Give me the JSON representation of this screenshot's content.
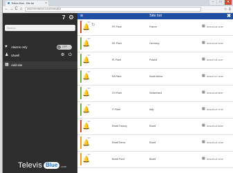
{
  "browser": {
    "tab_title": "Televis Blue - Site list",
    "url": "www.televisblue.com/#/sites/list",
    "win_min": "–",
    "win_max": "□",
    "win_close": "✕",
    "back": "←",
    "forward": "→",
    "reload": "C",
    "home": "⌂",
    "addr_right": "☆ ≡"
  },
  "sidebar": {
    "top_number": "7",
    "top_icon": "⚙",
    "search_placeholder": "Search",
    "alarms_label": "Alarms only",
    "alarms_icon": "♥",
    "toggle_label": "OFF",
    "user_label": "Utwell",
    "user_icon": "♟",
    "user_actions": "⚙ ⏻",
    "add_site_label": "Add site",
    "add_site_icon": "▦",
    "logo_word": "Televis",
    "logo_blue": "Blue",
    "logo_suffix": ".com"
  },
  "main": {
    "menu_icon": "≡",
    "title": "Site list",
    "close_icon": "✖"
  },
  "colors": {
    "ok": "#6fb04a",
    "alarm": "#d94a2a",
    "warning": "#f0a020",
    "header": "#1f4fa0",
    "sidebar": "#2d2d2d"
  },
  "rows": [
    {
      "bell": "🔔",
      "status": "alarm",
      "tag": "SM",
      "extra": "↻",
      "name": "FR Plant",
      "country": "France",
      "cal": "▦",
      "date": "2019-04-22 12:06"
    },
    {
      "bell": "🔔",
      "status": "ok",
      "tag": "SM",
      "extra": "",
      "name": "DE Plant",
      "country": "Germany",
      "cal": "▦",
      "date": "2019-04-22 10:55"
    },
    {
      "bell": "🔔",
      "status": "ok",
      "tag": "SM",
      "extra": "",
      "name": "PL Plant",
      "country": "Poland",
      "cal": "▦",
      "date": "2019-07-14 14:07"
    },
    {
      "bell": "🔔",
      "status": "ok",
      "tag": "SM",
      "extra": "",
      "name": "SA Plant",
      "country": "South Africa",
      "cal": "▦",
      "date": "2019-07-17 16:56"
    },
    {
      "bell": "🔔",
      "status": "ok",
      "tag": "SM",
      "extra": "",
      "name": "CH Plant",
      "country": "Switzerland",
      "cal": "▦",
      "date": "2019-06-06 08:57"
    },
    {
      "bell": "🔔",
      "status": "ok",
      "tag": "SM",
      "extra": "",
      "name": "IT Plant",
      "country": "Italy",
      "cal": "▦",
      "date": "2019-05-27 17:00"
    },
    {
      "bell": "🔔",
      "status": "alarm",
      "tag": "SM",
      "extra": "",
      "name": "Elwell Factory",
      "country": "Elwell",
      "cal": "▦",
      "date": "2019-05-21 09:05"
    },
    {
      "bell": "🔔",
      "status": "warning",
      "tag": "SM",
      "extra": "",
      "name": "Elwell Demo",
      "country": "Elwell",
      "cal": "▦",
      "date": "2019-05-21 10:48"
    },
    {
      "bell": "🔔",
      "status": "warning",
      "tag": "SM",
      "extra": "",
      "name": "Biwell Fund",
      "country": "Biwell",
      "cal": "▦",
      "date": "2019-05-21 10:30"
    }
  ],
  "outer": {
    "strip_text": "s"
  }
}
